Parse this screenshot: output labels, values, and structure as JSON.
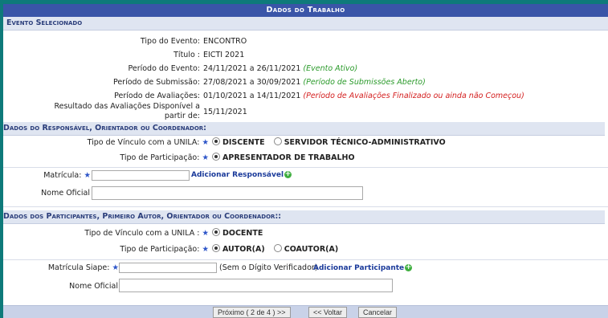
{
  "title": "Dados do Trabalho",
  "evento": {
    "heading": "Evento Selecionado",
    "tipo_label": "Tipo do Evento:",
    "tipo_value": "ENCONTRO",
    "titulo_label": "Título :",
    "titulo_value": "EICTI 2021",
    "periodo_evento_label": "Período do Evento:",
    "periodo_evento_value": "24/11/2021 a 26/11/2021",
    "periodo_evento_status": "(Evento Ativo)",
    "periodo_submissao_label": "Período de Submissão:",
    "periodo_submissao_value": "27/08/2021 a 30/09/2021",
    "periodo_submissao_status": "(Período de Submissões Aberto)",
    "periodo_avaliacoes_label": "Período de Avaliações:",
    "periodo_avaliacoes_value": "01/10/2021 a 14/11/2021",
    "periodo_avaliacoes_status": "(Período de Avaliações Finalizado ou ainda não Começou)",
    "resultado_label_1": "Resultado das Avaliações Disponível a",
    "resultado_label_2": "partir de:",
    "resultado_value": "15/11/2021"
  },
  "responsavel": {
    "heading": "Dados do Responsável, Orientador ou Coordenador:",
    "vinculo_label": "Tipo de Vínculo com a UNILA:",
    "vinculo_opt1": "DISCENTE",
    "vinculo_opt2": "SERVIDOR TÉCNICO-ADMINISTRATIVO",
    "participacao_label": "Tipo de Participação:",
    "participacao_opt1": "APRESENTADOR DE TRABALHO",
    "matricula_label": "Matrícula:",
    "matricula_value": "",
    "add_link": "Adicionar Responsável",
    "nome_label": "Nome Oficial",
    "nome_value": ""
  },
  "participantes": {
    "heading": "Dados dos Participantes, Primeiro Autor, Orientador ou Coordenador::",
    "vinculo_label": "Tipo de Vínculo com a UNILA :",
    "vinculo_opt1": "DOCENTE",
    "participacao_label": "Tipo de Participação:",
    "participacao_opt1": "AUTOR(A)",
    "participacao_opt2": "COAUTOR(A)",
    "matricula_label": "Matrícula Siape:",
    "matricula_value": "",
    "sem_digito": "(Sem o Dígito Verificador)",
    "add_link": "Adicionar Participante",
    "nome_label": "Nome Oficial",
    "nome_value": ""
  },
  "buttons": {
    "proximo": "Próximo ( 2 de 4 ) >>",
    "voltar": "<< Voltar",
    "cancelar": "Cancelar"
  },
  "required_mark": "★"
}
